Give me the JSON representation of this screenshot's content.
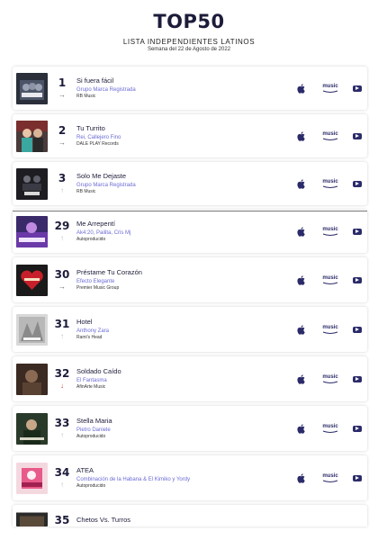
{
  "header": {
    "title": "TOP50",
    "subtitle": "LISTA INDEPENDIENTES LATINOS",
    "week": "Semana del 22 de Agosto de 2022"
  },
  "platforms": {
    "apple": "apple-music-icon",
    "amazon_label": "music",
    "youtube": "youtube-icon"
  },
  "colors": {
    "title": "#1c1c3a",
    "artist": "#6b6bd6",
    "icon": "#2b2b6a",
    "down_arrow": "#d43a3a"
  },
  "entries": [
    {
      "rank": "1",
      "move": "→",
      "trend": "same",
      "song": "Si fuera fácil",
      "artist": "Grupo Marca Registrada",
      "label": "RB Music"
    },
    {
      "rank": "2",
      "move": "→",
      "trend": "same",
      "song": "Tu Turrito",
      "artist": "Rei, Callejero Fino",
      "label": "DALE PLAY Records"
    },
    {
      "rank": "3",
      "move": "↑",
      "trend": "new",
      "song": "Solo Me Dejaste",
      "artist": "Grupo Marca Registrada",
      "label": "RB Music"
    },
    {
      "rank": "29",
      "move": "↑",
      "trend": "new",
      "song": "Me Arrepentí",
      "artist": "Ak4:20, Pailita, Cris Mj",
      "label": "Autoproducido"
    },
    {
      "rank": "30",
      "move": "→",
      "trend": "same",
      "song": "Préstame Tu Corazón",
      "artist": "Efecto Elegante",
      "label": "Premier Music Group"
    },
    {
      "rank": "31",
      "move": "↑",
      "trend": "new",
      "song": "Hotel",
      "artist": "Anthony Zara",
      "label": "Rami's Head"
    },
    {
      "rank": "32",
      "move": "↓",
      "trend": "down",
      "song": "Soldado Caído",
      "artist": "El Fantasma",
      "label": "AfinArte Music"
    },
    {
      "rank": "33",
      "move": "↑",
      "trend": "new",
      "song": "Stella Maria",
      "artist": "Pietro Daniele",
      "label": "Autoproducido"
    },
    {
      "rank": "34",
      "move": "↑",
      "trend": "new",
      "song": "ATEA",
      "artist": "Combinación de la Habana & El Kimiko y Yordy",
      "label": "Autoproducido"
    }
  ],
  "partial_entry": {
    "rank": "35",
    "song": "Chetos Vs. Turros"
  }
}
